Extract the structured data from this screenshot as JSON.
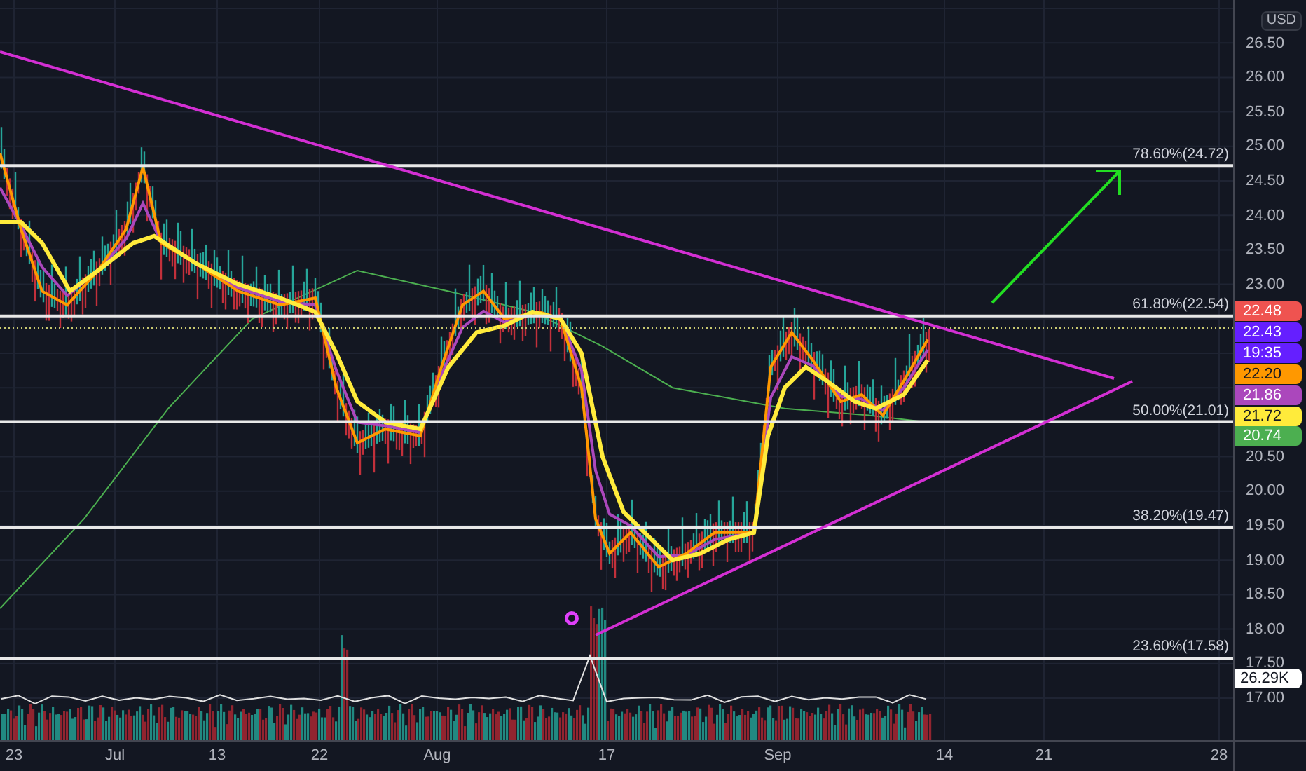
{
  "chart": {
    "currency": "USD",
    "price_axis_upper": [
      "26.50",
      "26.00",
      "25.50",
      "25.00",
      "24.50",
      "24.00",
      "23.50",
      "23.00"
    ],
    "price_axis_lower": [
      "20.50",
      "20.00",
      "19.50",
      "19.00",
      "18.50",
      "18.00",
      "17.50",
      "17.00"
    ],
    "time_axis": [
      "23",
      "Jul",
      "13",
      "22",
      "Aug",
      "17",
      "Sep",
      "14",
      "21",
      "28"
    ],
    "fib_levels": [
      {
        "label": "78.60%(24.72)"
      },
      {
        "label": "61.80%(22.54)"
      },
      {
        "label": "50.00%(21.01)"
      },
      {
        "label": "38.20%(19.47)"
      },
      {
        "label": "23.60%(17.58)"
      }
    ],
    "price_badges": [
      {
        "text": "22.48",
        "color": "#ef5350"
      },
      {
        "text": "22.43",
        "color": "#651fff"
      },
      {
        "text": "19:35",
        "color": "#651fff"
      },
      {
        "text": "22.20",
        "color": "#ff9800"
      },
      {
        "text": "21.86",
        "color": "#ab47bc"
      },
      {
        "text": "21.72",
        "color": "#ffeb3b"
      },
      {
        "text": "20.74",
        "color": "#4caf50"
      }
    ],
    "volume_badge": {
      "text": "26.29K"
    }
  }
}
